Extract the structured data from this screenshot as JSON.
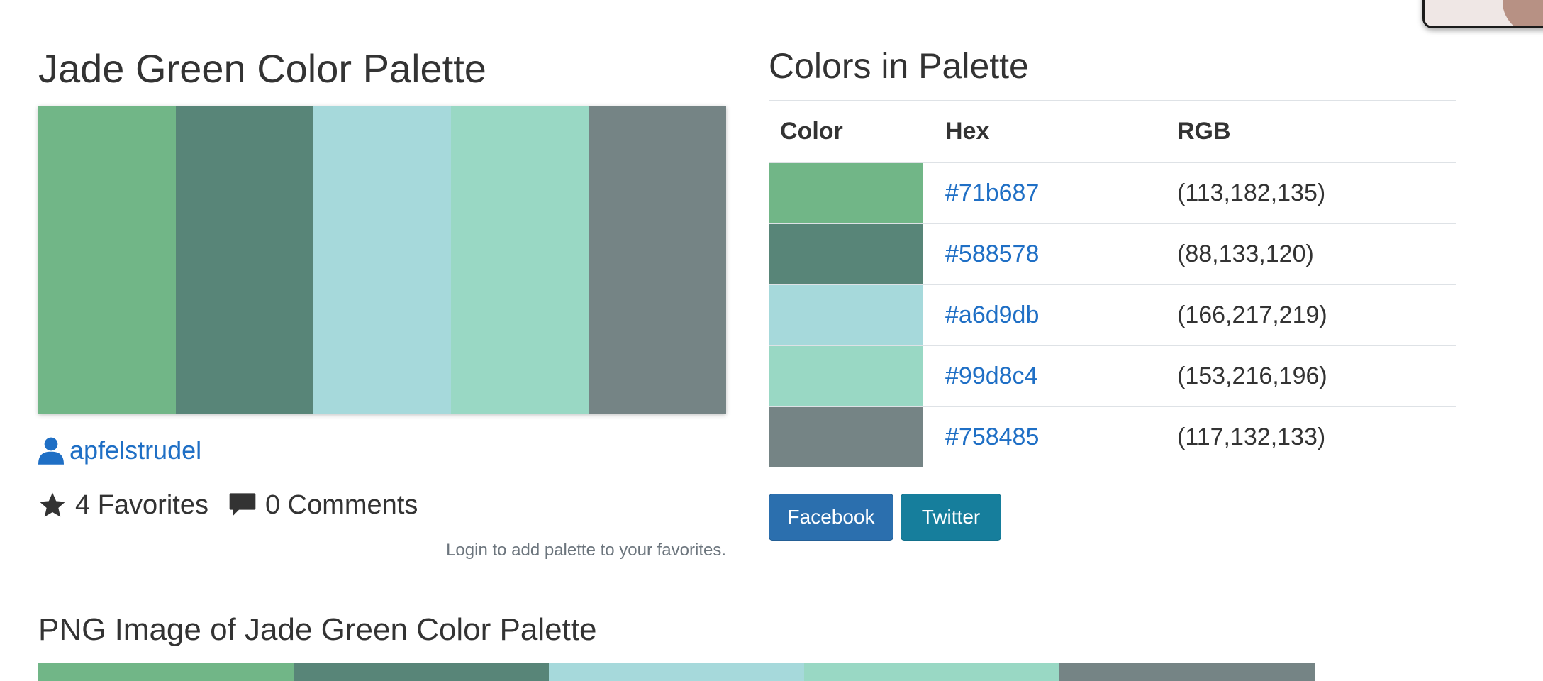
{
  "palette": {
    "title": "Jade Green Color Palette",
    "author": "apfelstrudel",
    "favorites_label": "4 Favorites",
    "comments_label": "0 Comments",
    "login_note": "Login to add palette to your favorites.",
    "colors": [
      "#71b687",
      "#588578",
      "#a6d9db",
      "#99d8c4",
      "#758485"
    ]
  },
  "colors_panel": {
    "heading": "Colors in Palette",
    "headers": {
      "color": "Color",
      "hex": "Hex",
      "rgb": "RGB"
    },
    "rows": [
      {
        "hex": "#71b687",
        "rgb": "(113,182,135)"
      },
      {
        "hex": "#588578",
        "rgb": "(88,133,120)"
      },
      {
        "hex": "#a6d9db",
        "rgb": "(166,217,219)"
      },
      {
        "hex": "#99d8c4",
        "rgb": "(153,216,196)"
      },
      {
        "hex": "#758485",
        "rgb": "(117,132,133)"
      }
    ]
  },
  "share": {
    "facebook_label": "Facebook",
    "twitter_label": "Twitter",
    "facebook_color": "#2b6fae",
    "twitter_color": "#167e9c"
  },
  "png_section": {
    "title": "PNG Image of Jade Green Color Palette"
  },
  "icons": {
    "author": "user-icon",
    "favorites": "star-icon",
    "comments": "comment-icon"
  },
  "accent_link_color": "#1f6fc5"
}
